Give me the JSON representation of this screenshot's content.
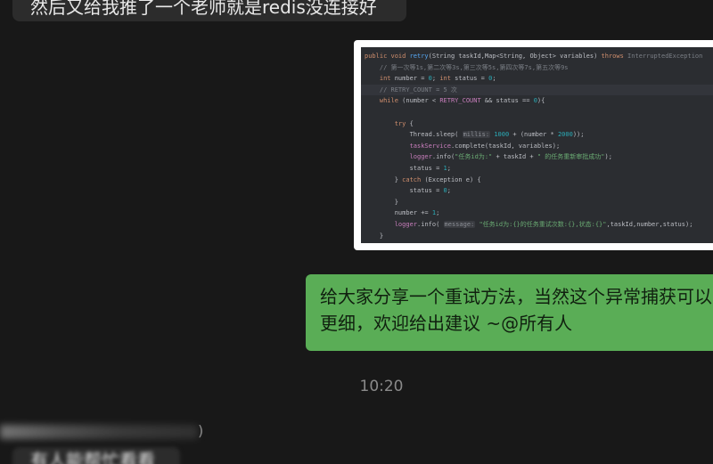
{
  "messages": {
    "top_partial": "然后又给我推了一个老师就是redis没连接好",
    "code_image": {
      "lines": [
        "public void retry(String taskId,Map<String, Object> variables) throws InterruptedException",
        "    // 第一次等1s,第二次等3s,第三次等5s,第四次等7s,第五次等9s",
        "    int number = 0; int status = 0;",
        "    // RETRY_COUNT = 5 次",
        "    while (number < RETRY_COUNT && status == 0){",
        "",
        "        try {",
        "            Thread.sleep( millis: 1000 + (number * 2000));",
        "            taskService.complete(taskId, variables);",
        "            logger.info(\"任务id为:\" + taskId + \" 的任务重新审批成功\");",
        "            status = 1;",
        "        } catch (Exception e) {",
        "            status = 0;",
        "        }",
        "        number += 1;",
        "        logger.info( message: \"任务id为:{}的任务重试次数:{},状态:{}\",taskId,number,status);",
        "    }"
      ]
    },
    "green_line1": "给大家分享一个重试方法，当然这个异常捕获可以",
    "green_line2": "更细，欢迎给出建议 ~@所有人",
    "timestamp": "10:20",
    "sender_paren": ")",
    "bottom_partial": "有人能帮忙看看"
  },
  "colors": {
    "background": "#181818",
    "left_bubble": "#2c2c2c",
    "green_bubble": "#5aad56",
    "code_bg": "#2b2d31"
  }
}
